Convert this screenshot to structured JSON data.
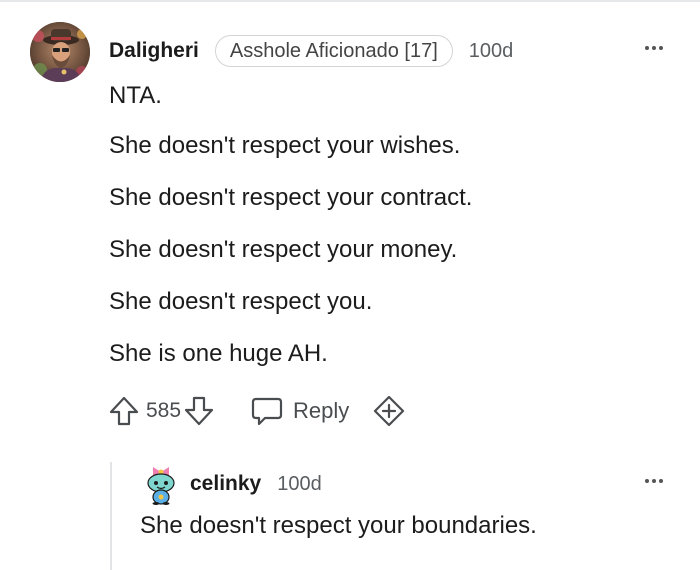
{
  "comment": {
    "username": "Daligheri",
    "flair": "Asshole Aficionado [17]",
    "timestamp": "100d",
    "avatar_icon": "user-avatar-icon",
    "paragraphs": [
      "NTA.",
      "She doesn't respect your wishes.",
      "She doesn't respect your contract.",
      "She doesn't respect your money.",
      "She doesn't respect you.",
      "She is one huge AH."
    ],
    "vote_count": "585",
    "reply_label": "Reply"
  },
  "reply": {
    "username": "celinky",
    "timestamp": "100d",
    "avatar_icon": "snoo-avatar-icon",
    "body": "She doesn't respect your boundaries."
  },
  "icons": {
    "upvote": "upvote-arrow-icon",
    "downvote": "downvote-arrow-icon",
    "reply": "speech-bubble-icon",
    "award": "award-plus-icon",
    "more": "more-options-icon"
  },
  "colors": {
    "text": "#1c1c1c",
    "meta": "#5a5e61",
    "icon": "#4a4d50",
    "border": "#d2d4d6",
    "thread_line": "#e2e4e6"
  }
}
